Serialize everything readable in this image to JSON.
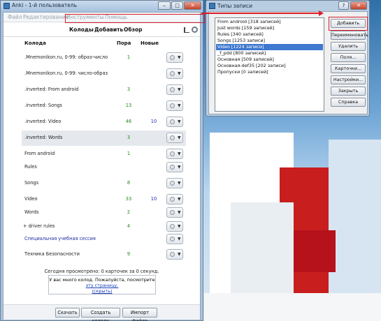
{
  "main_window": {
    "title": "Anki - 1-й пользователь",
    "menu": [
      {
        "label": "Файл"
      },
      {
        "label": "Редактирование"
      },
      {
        "label": "Инструменты"
      },
      {
        "label": "Помощь"
      }
    ],
    "toolbar": {
      "decks_label": "Колоды",
      "add_label": "Добавить",
      "browse_label": "Обзор"
    },
    "columns": {
      "deck": "Колода",
      "due": "Пора",
      "new": "Новые"
    },
    "decks": [
      {
        "name": ".Mnemonikon.ru, 0-99: образ-число",
        "due": "1",
        "new": ""
      },
      {
        "name": ".Mnemonikon.ru, 0-99: число-образ",
        "due": "",
        "new": ""
      },
      {
        "name": ".inverted: From android",
        "due": "3",
        "new": ""
      },
      {
        "name": ".inverted: Songs",
        "due": "13",
        "new": ""
      },
      {
        "name": ".inverted: Video",
        "due": "46",
        "new": "10"
      },
      {
        "name": ".inverted: Words",
        "due": "3",
        "new": ""
      },
      {
        "name": "From android",
        "due": "1",
        "new": ""
      },
      {
        "name": "Rules",
        "due": "",
        "new": ""
      },
      {
        "name": "Songs",
        "due": "8",
        "new": ""
      },
      {
        "name": "Video",
        "due": "33",
        "new": "10"
      },
      {
        "name": "Words",
        "due": "2",
        "new": ""
      },
      {
        "name": "+ driver rules",
        "due": "4",
        "new": ""
      },
      {
        "name": "Специальная учебная сессия",
        "due": "",
        "new": ""
      },
      {
        "name": "Техника Безопасности",
        "due": "9",
        "new": ""
      }
    ],
    "today_text": "Сегодня просмотрено: 0 карточек за 0 секунд.",
    "info": {
      "line1": "У вас много колод. Пожалуйста, посмотрите",
      "link": "эту страницу.",
      "hide": "(скрыть)"
    },
    "bottom_buttons": {
      "download": "Скачать",
      "create_deck": "Создать колоду",
      "import": "Импорт файла"
    }
  },
  "note_types_dialog": {
    "title": "Типы записи",
    "items": [
      "From android [318 записей]",
      "Just words [159 записей]",
      "Rules [340 записей]",
      "Songs [1253 записи]",
      "Video [1224 записи]",
      "_f_pdd [800 записей]",
      "Основная [509 записей]",
      "Основная-def35 [202 записи]",
      "Пропуски [0 записей]"
    ],
    "selected": "Video [1224 записи]",
    "buttons": {
      "add": "Добавить",
      "rename": "Переименовать",
      "delete": "Удалить",
      "fields": "Поля...",
      "cards": "Карточки...",
      "options": "Настройки...",
      "close": "Закрыть",
      "help": "Справка"
    }
  },
  "colors": {
    "highlight_red": "#d81e2a",
    "due_green": "#1d8a1d",
    "new_blue": "#1b2bb0",
    "selection_blue": "#3e78cf"
  }
}
